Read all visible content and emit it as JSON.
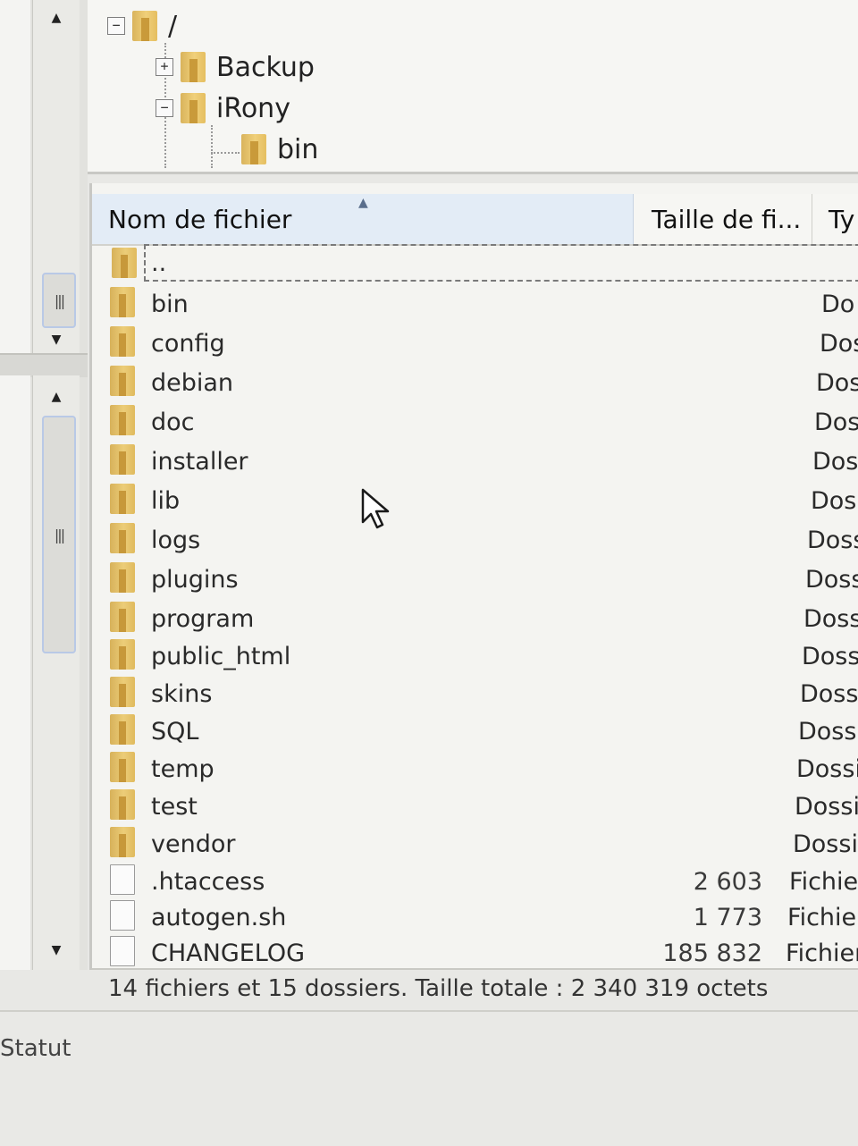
{
  "tree": {
    "root_label": "/",
    "nodes": [
      {
        "label": "Backup",
        "expander": "+"
      },
      {
        "label": "iRony",
        "expander": "−"
      },
      {
        "label": "bin"
      }
    ]
  },
  "filelist": {
    "headers": {
      "name": "Nom de fichier",
      "size": "Taille de fi...",
      "type": "Ty"
    },
    "rows": [
      {
        "name": "..",
        "size": "",
        "type": "",
        "kind": "folder"
      },
      {
        "name": "bin",
        "size": "",
        "type": "Do",
        "kind": "folder"
      },
      {
        "name": "config",
        "size": "",
        "type": "Dos",
        "kind": "folder"
      },
      {
        "name": "debian",
        "size": "",
        "type": "Dos",
        "kind": "folder"
      },
      {
        "name": "doc",
        "size": "",
        "type": "Dos",
        "kind": "folder"
      },
      {
        "name": "installer",
        "size": "",
        "type": "Dos",
        "kind": "folder"
      },
      {
        "name": "lib",
        "size": "",
        "type": "Dos",
        "kind": "folder"
      },
      {
        "name": "logs",
        "size": "",
        "type": "Doss",
        "kind": "folder"
      },
      {
        "name": "plugins",
        "size": "",
        "type": "Doss",
        "kind": "folder"
      },
      {
        "name": "program",
        "size": "",
        "type": "Doss",
        "kind": "folder"
      },
      {
        "name": "public_html",
        "size": "",
        "type": "Dossi",
        "kind": "folder"
      },
      {
        "name": "skins",
        "size": "",
        "type": "Dossi",
        "kind": "folder"
      },
      {
        "name": "SQL",
        "size": "",
        "type": "Dossi",
        "kind": "folder"
      },
      {
        "name": "temp",
        "size": "",
        "type": "Dossie",
        "kind": "folder"
      },
      {
        "name": "test",
        "size": "",
        "type": "Dossie",
        "kind": "folder"
      },
      {
        "name": "vendor",
        "size": "",
        "type": "Dossie",
        "kind": "folder"
      },
      {
        "name": ".htaccess",
        "size": "2 603",
        "type": "Fichier",
        "kind": "file"
      },
      {
        "name": "autogen.sh",
        "size": "1 773",
        "type": "Fichier",
        "kind": "file"
      },
      {
        "name": "CHANGELOG",
        "size": "185 832",
        "type": "Fichier",
        "kind": "file"
      }
    ],
    "summary": "14 fichiers et 15 dossiers. Taille totale : 2 340 319 octets"
  },
  "status_panel": {
    "label": "Statut"
  },
  "icons": {
    "folder": "folder-icon",
    "file": "file-icon",
    "scroll_up": "scroll-up-arrow-icon",
    "scroll_down": "scroll-down-arrow-icon",
    "cursor": "mouse-cursor-icon"
  },
  "colors": {
    "header_active": "#e3ecf6",
    "folder": "#e5be60",
    "background": "#f4f4f1"
  }
}
